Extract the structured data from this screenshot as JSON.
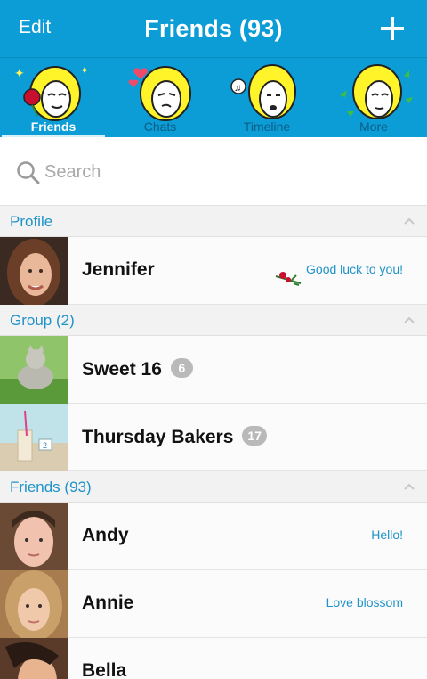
{
  "header": {
    "edit_label": "Edit",
    "title": "Friends (93)",
    "add_icon": "plus-icon"
  },
  "tabs": [
    {
      "label": "Friends",
      "active": true,
      "icon": "friends-sticker-icon"
    },
    {
      "label": "Chats",
      "active": false,
      "icon": "chats-sticker-icon"
    },
    {
      "label": "Timeline",
      "active": false,
      "icon": "timeline-sticker-icon"
    },
    {
      "label": "More",
      "active": false,
      "icon": "more-sticker-icon"
    }
  ],
  "search": {
    "placeholder": "Search",
    "icon": "search-icon"
  },
  "sections": {
    "profile": {
      "title": "Profile"
    },
    "group": {
      "title": "Group (2)"
    },
    "friends": {
      "title": "Friends (93)"
    }
  },
  "profile": {
    "name": "Jennifer",
    "status": "Good luck to you!"
  },
  "groups": [
    {
      "name": "Sweet 16",
      "count": "6"
    },
    {
      "name": "Thursday Bakers",
      "count": "17"
    }
  ],
  "friends": [
    {
      "name": "Andy",
      "status": "Hello!"
    },
    {
      "name": "Annie",
      "status": "Love blossom"
    },
    {
      "name": "Bella",
      "status": ""
    }
  ],
  "colors": {
    "brand": "#0c9cd6",
    "section_text": "#1e93c8",
    "badge": "#b9b9b9"
  }
}
